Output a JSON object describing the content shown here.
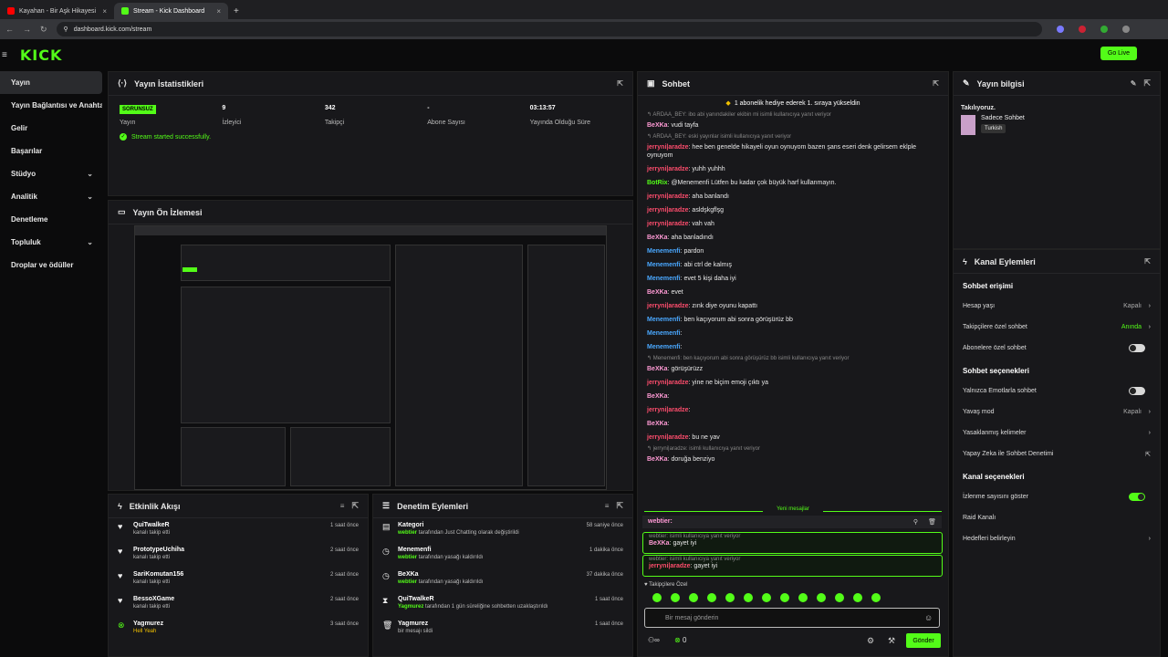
{
  "browser": {
    "tabs": [
      {
        "title": "Kayahan - Bir Aşk Hikayesi"
      },
      {
        "title": "Stream - Kick Dashboard"
      }
    ],
    "url": "dashboard.kick.com/stream"
  },
  "header": {
    "logo": "KICK",
    "go_live": "Go Live"
  },
  "sidebar": {
    "items": [
      {
        "label": "Yayın"
      },
      {
        "label": "Yayın Bağlantısı ve Anahtarı"
      },
      {
        "label": "Gelir"
      },
      {
        "label": "Başarılar"
      },
      {
        "label": "Stüdyo"
      },
      {
        "label": "Analitik"
      },
      {
        "label": "Denetleme"
      },
      {
        "label": "Topluluk"
      },
      {
        "label": "Droplar ve ödüller"
      }
    ]
  },
  "stats_panel": {
    "title": "Yayın İstatistikleri",
    "status_badge": "SORUNSUZ",
    "status_label": "Yayın",
    "stats": [
      {
        "value": "9",
        "label": "İzleyici"
      },
      {
        "value": "342",
        "label": "Takipçi"
      },
      {
        "value": "-",
        "label": "Abone Sayısı"
      },
      {
        "value": "03:13:57",
        "label": "Yayında Olduğu Süre"
      }
    ],
    "success_msg": "Stream started successfully."
  },
  "preview_panel": {
    "title": "Yayın Ön İzlemesi"
  },
  "activity_panel": {
    "title": "Etkinlik Akışı",
    "items": [
      {
        "name": "QuiTwalkeR",
        "sub": "kanalı takip etti",
        "time": "1 saat önce"
      },
      {
        "name": "PrototypeUchiha",
        "sub": "kanalı takip etti",
        "time": "2 saat önce"
      },
      {
        "name": "SariKomutan156",
        "sub": "kanalı takip etti",
        "time": "2 saat önce"
      },
      {
        "name": "BessoXGame",
        "sub": "kanalı takip etti",
        "time": "2 saat önce"
      },
      {
        "name": "Yagmurez",
        "sub": "Hell Yeah",
        "time": "3 saat önce"
      }
    ]
  },
  "moderation_panel": {
    "title": "Denetim Eylemleri",
    "items": [
      {
        "name": "Kategori",
        "actor": "webtier",
        "sub": "tarafından Just Chatting olarak değiştirildi",
        "time": "58 saniye önce"
      },
      {
        "name": "Menemenfi",
        "actor": "webtier",
        "sub": "tarafından yasağı kaldırıldı",
        "time": "1 dakika önce"
      },
      {
        "name": "BeXKa",
        "actor": "webtier",
        "sub": "tarafından yasağı kaldırıldı",
        "time": "37 dakika önce"
      },
      {
        "name": "QuiTwalkeR",
        "actor": "Yagmurez",
        "sub": "tarafından 1 gün süreliğine sohbetten uzaklaştırıldı",
        "time": "1 saat önce"
      },
      {
        "name": "Yagmurez",
        "actor": "",
        "sub": "bir mesajı sildi",
        "time": "1 saat önce"
      }
    ]
  },
  "chat_panel": {
    "title": "Sohbet",
    "gift_msg": "1 abonelik hediye ederek 1. sıraya yükseldin",
    "messages": [
      {
        "reply": "ARDAA_BEY: ibo abi yanındakiler ekibin mi isimli kullanıcıya yanıt veriyor",
        "user": "BeXKa",
        "color": "#ff9ad5",
        "text": ": vudi tayfa"
      },
      {
        "reply": "ARDAA_BEY: eski yayınlar isimli kullanıcıya yanıt veriyor",
        "user": "jerryni|aradze",
        "color": "#ff4d6d",
        "text": ": hee ben genelde hikayeli oyun oynuyom bazen şans eseri denk gelirsem eklple oynuyom"
      },
      {
        "reply": "",
        "user": "jerryni|aradze",
        "color": "#ff4d6d",
        "text": ": yuhh yuhhh"
      },
      {
        "reply": "",
        "user": "BotRix",
        "color": "#53fc18",
        "text": ": @Menemenfi Lütfen bu kadar çok büyük harf kullanmayın."
      },
      {
        "reply": "",
        "user": "jerryni|aradze",
        "color": "#ff4d6d",
        "text": ": aha banlandı"
      },
      {
        "reply": "",
        "user": "jerryni|aradze",
        "color": "#ff4d6d",
        "text": ": asldşkgflşg"
      },
      {
        "reply": "",
        "user": "jerryni|aradze",
        "color": "#ff4d6d",
        "text": ": vah vah"
      },
      {
        "reply": "",
        "user": "BeXKa",
        "color": "#ff9ad5",
        "text": ": aha banladındı"
      },
      {
        "reply": "",
        "user": "Menemenfi",
        "color": "#4aa8ff",
        "text": ": pardon"
      },
      {
        "reply": "",
        "user": "Menemenfi",
        "color": "#4aa8ff",
        "text": ": abi ctrl de kalmış"
      },
      {
        "reply": "",
        "user": "Menemenfi",
        "color": "#4aa8ff",
        "text": ": evet 5 kişi daha iyi"
      },
      {
        "reply": "",
        "user": "BeXKa",
        "color": "#ff9ad5",
        "text": ": evet"
      },
      {
        "reply": "",
        "user": "jerryni|aradze",
        "color": "#ff4d6d",
        "text": ": zınk diye oyunu kapattı"
      },
      {
        "reply": "",
        "user": "Menemenfi",
        "color": "#4aa8ff",
        "text": ": ben kaçıyorum abi sonra görüşürüz bb"
      },
      {
        "reply": "",
        "user": "Menemenfi",
        "color": "#4aa8ff",
        "text": ":"
      },
      {
        "reply": "",
        "user": "Menemenfi",
        "color": "#4aa8ff",
        "text": ":"
      },
      {
        "reply": "Menemenfi: ben kaçıyorum abi sonra görüşürüz bb isimli kullanıcıya yanıt veriyor",
        "user": "BeXKa",
        "color": "#ff9ad5",
        "text": ": görüşürüzz"
      },
      {
        "reply": "",
        "user": "jerryni|aradze",
        "color": "#ff4d6d",
        "text": ": yine ne biçim emoji çıktı ya"
      },
      {
        "reply": "",
        "user": "BeXKa",
        "color": "#ff9ad5",
        "text": ":"
      },
      {
        "reply": "",
        "user": "jerryni|aradze",
        "color": "#ff4d6d",
        "text": ":"
      },
      {
        "reply": "",
        "user": "BeXKa",
        "color": "#ff9ad5",
        "text": ":"
      },
      {
        "reply": "",
        "user": "jerryni|aradze",
        "color": "#ff4d6d",
        "text": ": bu ne yav"
      },
      {
        "reply": "jerryni|aradze: isimli kullanıcıya yanıt veriyor",
        "user": "BeXKa",
        "color": "#ff9ad5",
        "text": ": doruğa benziyo"
      }
    ],
    "new_messages": "Yeni mesajlar",
    "pinned_user": "webtier:",
    "highlight1_reply": "webtier: isimli kullanıcıya yanıt veriyor",
    "highlight1_user": "BeXKa",
    "highlight1_text": ": gayet iyi",
    "highlight2_reply": "webtier: isimli kullanıcıya yanıt veriyor",
    "highlight2_user": "jerryni|aradze",
    "highlight2_text": ": gayet iyi",
    "followers_only": "Takipçilere Özel",
    "placeholder": "Bir mesaj gönderin",
    "count": "0",
    "send": "Gönder"
  },
  "info_panel": {
    "title": "Yayın bilgisi",
    "status_text": "Takılıyoruz.",
    "category": "Sadece Sohbet",
    "language": "Turkish"
  },
  "channel_actions": {
    "title": "Kanal Eylemleri",
    "chat_access": "Sohbet erişimi",
    "account_age": "Hesap yaşı",
    "account_age_val": "Kapalı",
    "followers_only": "Takipçilere özel sohbet",
    "followers_only_val": "Anında",
    "subs_only": "Abonelere özel sohbet",
    "chat_options": "Sohbet seçenekleri",
    "emotes_only": "Yalnızca Emotlarla sohbet",
    "slow_mode": "Yavaş mod",
    "slow_mode_val": "Kapalı",
    "banned_words": "Yasaklanmış kelimeler",
    "ai_moderation": "Yapay Zeka ile Sohbet Denetimi",
    "channel_options": "Kanal seçenekleri",
    "show_viewers": "İzlenme sayısını göster",
    "raid": "Raid Kanalı",
    "goals": "Hedefleri belirleyin"
  }
}
